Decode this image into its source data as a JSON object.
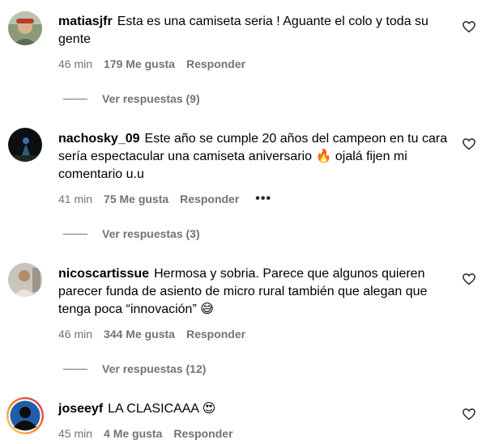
{
  "comments": [
    {
      "username": "matiasjfr",
      "text": "Esta es una camiseta seria ! Aguante el colo y toda su gente",
      "time": "46 min",
      "likes": "179 Me gusta",
      "reply": "Responder",
      "replies": "Ver respuestas (9)",
      "avatar_icon": "profile-photo"
    },
    {
      "username": "nachosky_09",
      "text": "Este año se cumple 20 años del campeon en tu cara sería espectacular una camiseta aniversario 🔥 ojalá fijen mi comentario u.u",
      "time": "41 min",
      "likes": "75 Me gusta",
      "reply": "Responder",
      "more": "•••",
      "replies": "Ver respuestas (3)",
      "avatar_icon": "profile-photo"
    },
    {
      "username": "nicoscartissue",
      "text": "Hermosa y sobria. Parece que algunos quieren parecer funda de asiento de micro rural también que alegan que tenga poca “innovación” 😅",
      "time": "46 min",
      "likes": "344 Me gusta",
      "reply": "Responder",
      "replies": "Ver respuestas (12)",
      "avatar_icon": "profile-photo"
    },
    {
      "username": "joseeyf",
      "text": "LA CLASICAAA 😍",
      "time": "45 min",
      "likes": "4 Me gusta",
      "reply": "Responder",
      "avatar_icon": "story-ring-avatar"
    }
  ],
  "colors": {
    "meta": "#737373",
    "story_ring_start": "#feda75",
    "story_ring_end": "#d62976"
  },
  "icons": {
    "like": "heart-outline-icon"
  }
}
